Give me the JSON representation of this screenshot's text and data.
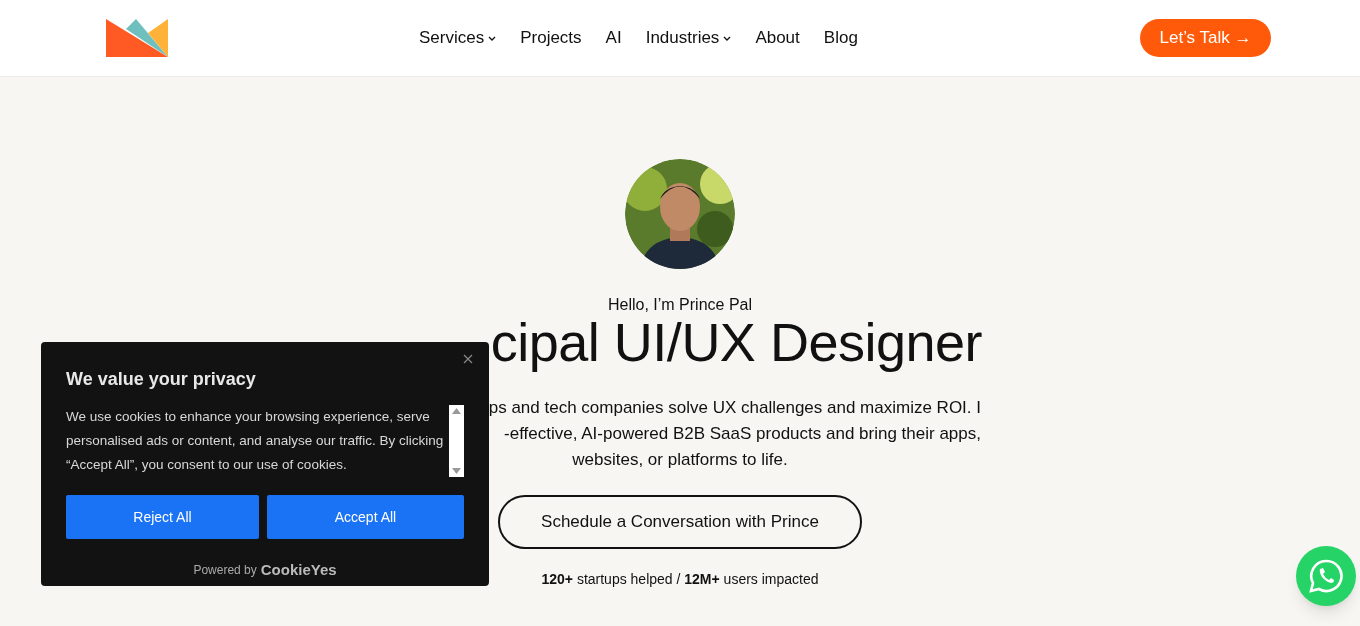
{
  "nav": {
    "items": [
      {
        "label": "Services",
        "has_dropdown": true
      },
      {
        "label": "Projects",
        "has_dropdown": false
      },
      {
        "label": "AI",
        "has_dropdown": false
      },
      {
        "label": "Industries",
        "has_dropdown": true
      },
      {
        "label": "About",
        "has_dropdown": false
      },
      {
        "label": "Blog",
        "has_dropdown": false
      }
    ],
    "cta": "Let’s Talk →"
  },
  "hero": {
    "greeting": "Hello, I’m Prince Pal",
    "title": "cipal UI/UX Designer",
    "description_lines": [
      "ps and tech companies solve UX challenges and maximize ROI. I",
      "-effective, AI-powered B2B SaaS products and bring their apps,",
      "websites, or platforms to life."
    ],
    "button": "Schedule a Conversation with Prince",
    "stats": "**120+** startups helped / **12M+** users impacted"
  },
  "cookie_banner": {
    "title": "We value your privacy",
    "text": "We use cookies to enhance your browsing experience, serve personalised ads or content, and analyse our traffic. By clicking “Accept All”, you consent to our use of cookies.",
    "buttons": [
      "Reject All",
      "Accept All"
    ],
    "powered_by": "Powered by",
    "brand": "CookieYes"
  }
}
